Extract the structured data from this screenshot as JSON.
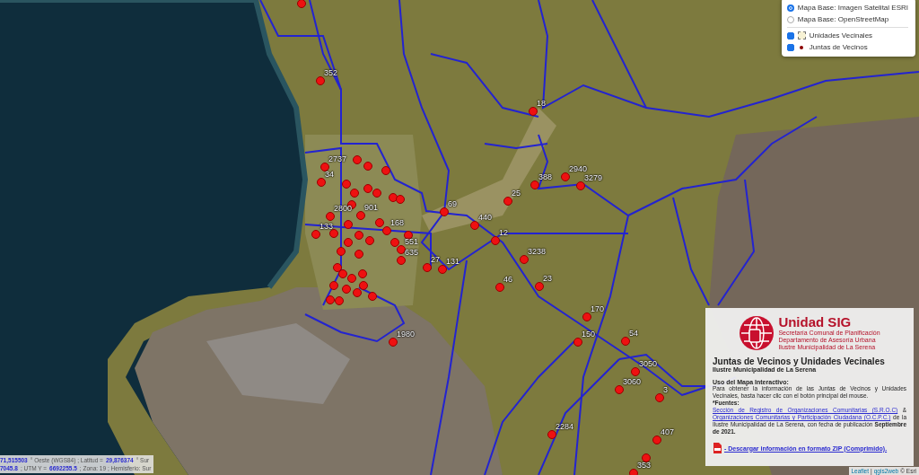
{
  "layer_control": {
    "base_layers": [
      {
        "label": "Mapa Base: Imagen Satelital ESRI",
        "selected": true
      },
      {
        "label": "Mapa Base: OpenStreetMap",
        "selected": false
      }
    ],
    "overlays": [
      {
        "label": "Unidades Vecinales",
        "checked": true,
        "kind": "area"
      },
      {
        "label": "Juntas de Vecinos",
        "checked": true,
        "kind": "point"
      }
    ]
  },
  "markers": [
    "352",
    "18",
    "2737",
    "34",
    "2800",
    "133",
    "901",
    "168",
    "551",
    "635",
    "27",
    "131",
    "69",
    "440",
    "12",
    "3238",
    "46",
    "23",
    "25",
    "388",
    "2940",
    "3279",
    "170",
    "150",
    "54",
    "3050",
    "3060",
    "3",
    "2284",
    "407",
    "353",
    "1980"
  ],
  "info_panel": {
    "logo_title": "Unidad SIG",
    "logo_lines": [
      "Secretaría Comunal de Planificación",
      "Departamento de Asesoría Urbana",
      "Ilustre Municipalidad de La Serena"
    ],
    "title": "Juntas de Vecinos y Unidades Vecinales",
    "subtitle": "Ilustre Municipalidad de La Serena",
    "usage_heading": "Uso del Mapa Interactivo:",
    "usage_text": "Para obtener la información de las Juntas de Vecinos y Unidades Vecinales, basta hacer clic con el botón principal del mouse.",
    "sources_label": "*Fuentes:",
    "sources_link_1": "Sección de Registro de Organizaciones Comunitarias (S.R.O.C)",
    "sources_amp": "&",
    "sources_link_2": "Organizaciones Comunitarias y Participación Ciudadana (O.C.P.C.)",
    "sources_text": "de la Ilustre Municipalidad de La Serena, con fecha de publicación **Septiembre de 2021.**",
    "download_link": "- Descargar información en formato ZIP (Comprimido)."
  },
  "coordinates": [
    [
      {
        "text": "71,515503",
        "kind": "value"
      },
      {
        "text": "° Oeste (WGS84) ; Latitud =",
        "kind": "label"
      },
      {
        "text": "29,876374",
        "kind": "value"
      },
      {
        "text": "° Sur",
        "kind": "label"
      }
    ],
    [
      {
        "text": "7045.8",
        "kind": "value"
      },
      {
        "text": "; UTM Y =",
        "kind": "label"
      },
      {
        "text": "6692255.5",
        "kind": "value"
      },
      {
        "text": "; Zona: 19 ; Hemisferio: Sur",
        "kind": "label"
      }
    ]
  ],
  "attribution": [
    {
      "text": "Leaflet",
      "kind": "link"
    },
    {
      "text": "|",
      "kind": "text"
    },
    {
      "text": "qgis2web",
      "kind": "link"
    },
    {
      "text": "© Esri",
      "kind": "text"
    }
  ]
}
